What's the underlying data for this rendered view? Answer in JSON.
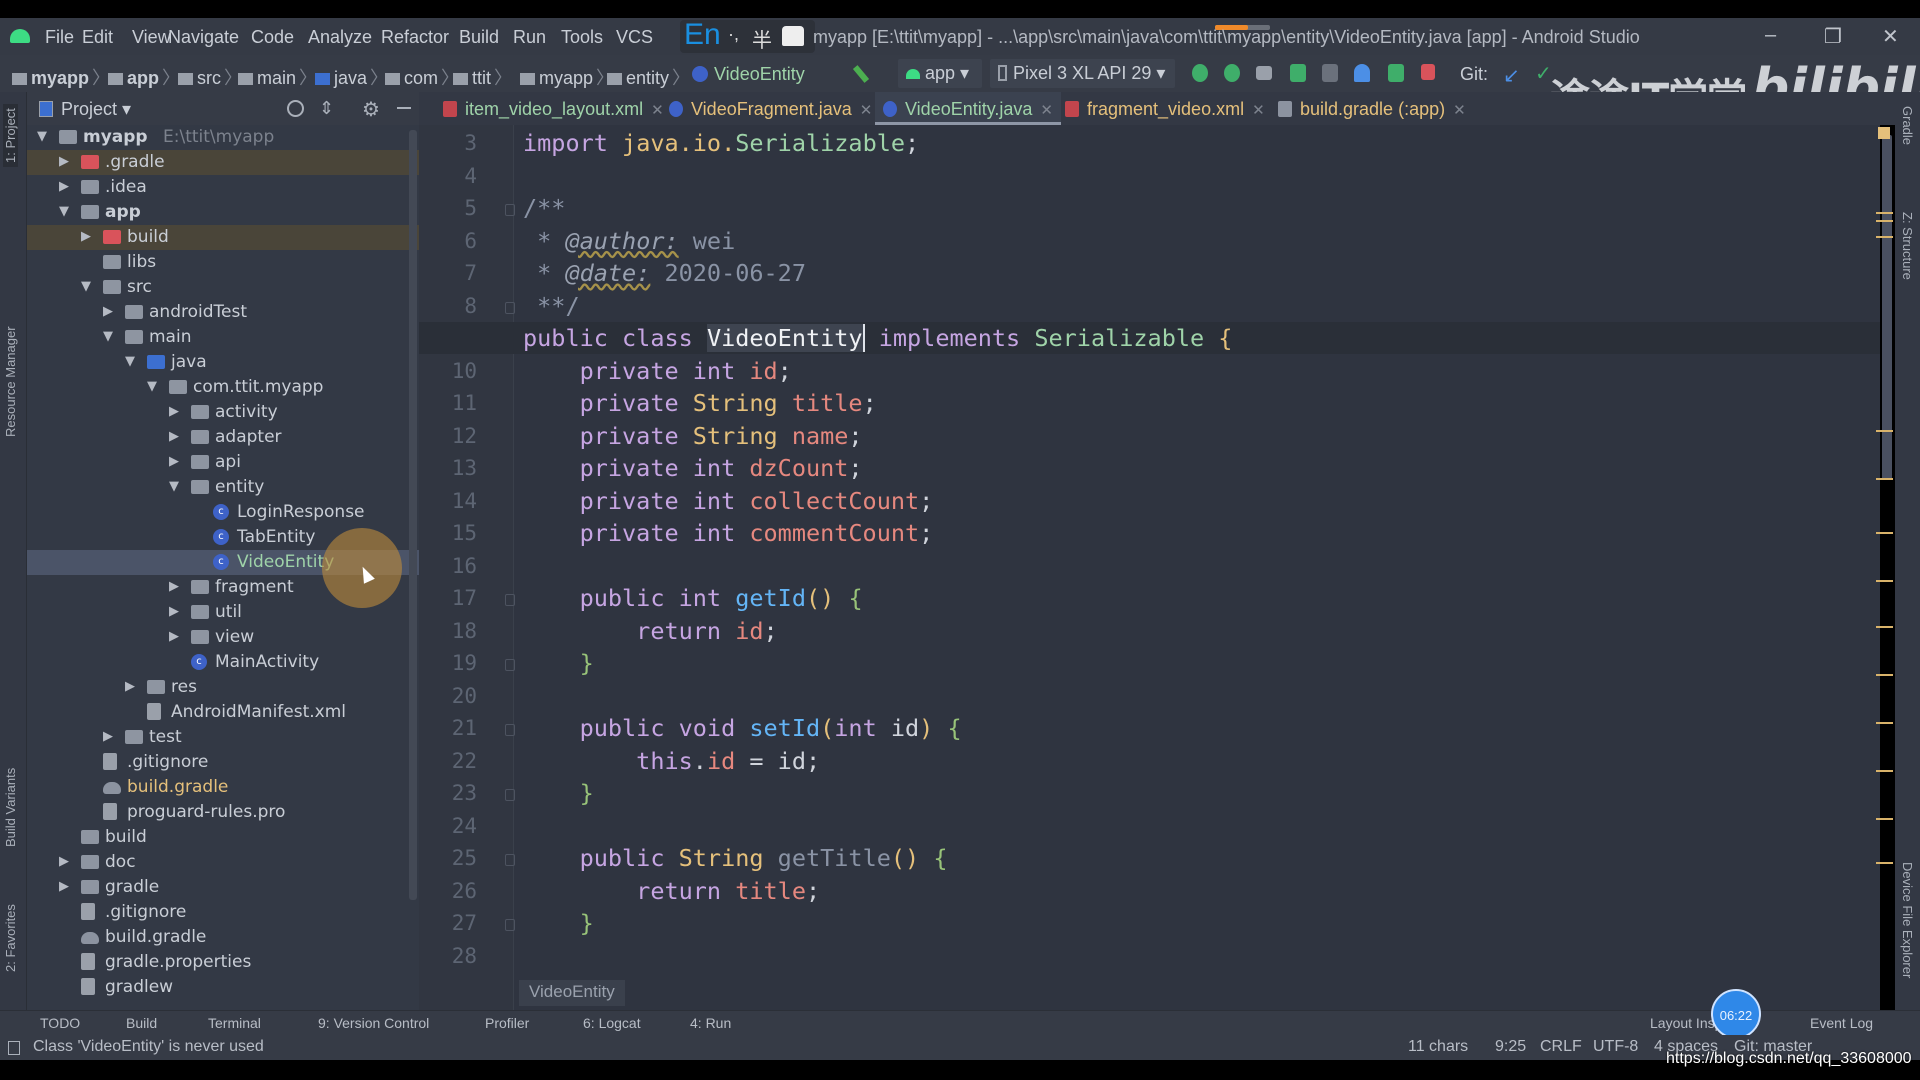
{
  "menu": [
    "File",
    "Edit",
    "View",
    "Navigate",
    "Code",
    "Analyze",
    "Refactor",
    "Build",
    "Run",
    "Tools",
    "VCS"
  ],
  "ime": {
    "lang": "En",
    "punct": "·,",
    "width": "半"
  },
  "window_title": "myapp [E:\\ttit\\myapp] - ...\\app\\src\\main\\java\\com\\ttit\\myapp\\entity\\VideoEntity.java [app] - Android Studio",
  "window_controls": {
    "minimize": "–",
    "restore": "❐",
    "close": "✕"
  },
  "breadcrumb": [
    "myapp",
    "app",
    "src",
    "main",
    "java",
    "com",
    "ttit",
    "myapp",
    "entity",
    "VideoEntity"
  ],
  "toolbar": {
    "run_config": "app",
    "device": "Pixel 3 XL API 29",
    "git_label": "Git:"
  },
  "watermark": {
    "channel": "途途IT学堂",
    "brand": "bilibili"
  },
  "project_panel": {
    "title": "Project"
  },
  "tree": [
    {
      "label": "myapp",
      "depth": 0,
      "state": "open",
      "icon": "module",
      "bold": true,
      "suffix": "E:\\ttit\\myapp"
    },
    {
      "label": ".gradle",
      "depth": 1,
      "state": "closed",
      "icon": "red",
      "hl": true
    },
    {
      "label": ".idea",
      "depth": 1,
      "state": "closed",
      "icon": "folder"
    },
    {
      "label": "app",
      "depth": 1,
      "state": "open",
      "icon": "folder",
      "bold": true
    },
    {
      "label": "build",
      "depth": 2,
      "state": "closed",
      "icon": "red",
      "hl": true
    },
    {
      "label": "libs",
      "depth": 2,
      "state": "none",
      "icon": "folder"
    },
    {
      "label": "src",
      "depth": 2,
      "state": "open",
      "icon": "folder"
    },
    {
      "label": "androidTest",
      "depth": 3,
      "state": "closed",
      "icon": "folder"
    },
    {
      "label": "main",
      "depth": 3,
      "state": "open",
      "icon": "folder"
    },
    {
      "label": "java",
      "depth": 4,
      "state": "open",
      "icon": "blue"
    },
    {
      "label": "com.ttit.myapp",
      "depth": 5,
      "state": "open",
      "icon": "pkg"
    },
    {
      "label": "activity",
      "depth": 6,
      "state": "closed",
      "icon": "pkg"
    },
    {
      "label": "adapter",
      "depth": 6,
      "state": "closed",
      "icon": "pkg"
    },
    {
      "label": "api",
      "depth": 6,
      "state": "closed",
      "icon": "pkg"
    },
    {
      "label": "entity",
      "depth": 6,
      "state": "open",
      "icon": "pkg"
    },
    {
      "label": "LoginResponse",
      "depth": 7,
      "state": "none",
      "icon": "cls"
    },
    {
      "label": "TabEntity",
      "depth": 7,
      "state": "none",
      "icon": "cls"
    },
    {
      "label": "VideoEntity",
      "depth": 7,
      "state": "none",
      "icon": "cls",
      "selected": true
    },
    {
      "label": "fragment",
      "depth": 6,
      "state": "closed",
      "icon": "pkg"
    },
    {
      "label": "util",
      "depth": 6,
      "state": "closed",
      "icon": "pkg"
    },
    {
      "label": "view",
      "depth": 6,
      "state": "closed",
      "icon": "pkg"
    },
    {
      "label": "MainActivity",
      "depth": 6,
      "state": "none",
      "icon": "cls"
    },
    {
      "label": "res",
      "depth": 4,
      "state": "closed",
      "icon": "folder"
    },
    {
      "label": "AndroidManifest.xml",
      "depth": 4,
      "state": "none",
      "icon": "file"
    },
    {
      "label": "test",
      "depth": 3,
      "state": "closed",
      "icon": "folder"
    },
    {
      "label": ".gitignore",
      "depth": 2,
      "state": "none",
      "icon": "file"
    },
    {
      "label": "build.gradle",
      "depth": 2,
      "state": "none",
      "icon": "gradle",
      "modified": true
    },
    {
      "label": "proguard-rules.pro",
      "depth": 2,
      "state": "none",
      "icon": "file"
    },
    {
      "label": "build",
      "depth": 1,
      "state": "none",
      "icon": "folder"
    },
    {
      "label": "doc",
      "depth": 1,
      "state": "closed",
      "icon": "folder"
    },
    {
      "label": "gradle",
      "depth": 1,
      "state": "closed",
      "icon": "folder"
    },
    {
      "label": ".gitignore",
      "depth": 1,
      "state": "none",
      "icon": "file"
    },
    {
      "label": "build.gradle",
      "depth": 1,
      "state": "none",
      "icon": "gradle"
    },
    {
      "label": "gradle.properties",
      "depth": 1,
      "state": "none",
      "icon": "file"
    },
    {
      "label": "gradlew",
      "depth": 1,
      "state": "none",
      "icon": "file"
    }
  ],
  "tabs": [
    {
      "label": "item_video_layout.xml",
      "color": "#9fd3a9",
      "icon": "#c2454d"
    },
    {
      "label": "VideoFragment.java",
      "color": "#e5c07b",
      "icon": "#3e62c8"
    },
    {
      "label": "VideoEntity.java",
      "color": "#9fd3a9",
      "icon": "#3e62c8",
      "active": true
    },
    {
      "label": "fragment_video.xml",
      "color": "#e5c07b",
      "icon": "#c2454d"
    },
    {
      "label": "build.gradle (:app)",
      "color": "#e5c07b",
      "icon": "#8c93a0"
    }
  ],
  "editor": {
    "current_line": 9,
    "first_line": 3,
    "lines": [
      [
        [
          "import ",
          "kw"
        ],
        [
          "java.io.",
          "type"
        ],
        [
          "Serializable",
          "cls"
        ],
        [
          ";",
          "plain"
        ]
      ],
      [],
      [
        [
          "/**",
          "cm"
        ]
      ],
      [
        [
          " * ",
          "cm"
        ],
        [
          "@author:",
          "doctag"
        ],
        [
          " wei",
          "cm"
        ]
      ],
      [
        [
          " * ",
          "cm"
        ],
        [
          "@date:",
          "doctag"
        ],
        [
          " 2020-06-27",
          "cm"
        ]
      ],
      [
        [
          " **/",
          "cm"
        ]
      ],
      [
        [
          "public class ",
          "kw"
        ],
        [
          "VideoEntity",
          "hl"
        ],
        [
          " implements ",
          "kw"
        ],
        [
          "Serializable",
          "cls"
        ],
        [
          " {",
          "brace"
        ]
      ],
      [
        [
          "    private int ",
          "kw"
        ],
        [
          "id",
          "fld"
        ],
        [
          ";",
          "plain"
        ]
      ],
      [
        [
          "    private ",
          "kw"
        ],
        [
          "String",
          "type"
        ],
        [
          " title",
          "fld"
        ],
        [
          ";",
          "plain"
        ]
      ],
      [
        [
          "    private ",
          "kw"
        ],
        [
          "String",
          "type"
        ],
        [
          " name",
          "fld"
        ],
        [
          ";",
          "plain"
        ]
      ],
      [
        [
          "    private int ",
          "kw"
        ],
        [
          "dzCount",
          "fld"
        ],
        [
          ";",
          "plain"
        ]
      ],
      [
        [
          "    private int ",
          "kw"
        ],
        [
          "collectCount",
          "fld"
        ],
        [
          ";",
          "plain"
        ]
      ],
      [
        [
          "    private int ",
          "kw"
        ],
        [
          "commentCount",
          "fld"
        ],
        [
          ";",
          "plain"
        ]
      ],
      [],
      [
        [
          "    public int ",
          "kw"
        ],
        [
          "getId",
          "fn"
        ],
        [
          "() ",
          "brace"
        ],
        [
          "{",
          "gbr"
        ]
      ],
      [
        [
          "        return ",
          "kw"
        ],
        [
          "id",
          "fld"
        ],
        [
          ";",
          "plain"
        ]
      ],
      [
        [
          "    }",
          "gbr"
        ]
      ],
      [],
      [
        [
          "    public void ",
          "kw"
        ],
        [
          "setId",
          "fn"
        ],
        [
          "(",
          "brace"
        ],
        [
          "int ",
          "kw"
        ],
        [
          "id",
          "plain"
        ],
        [
          ") ",
          "brace"
        ],
        [
          "{",
          "gbr"
        ]
      ],
      [
        [
          "        this",
          "kw"
        ],
        [
          ".",
          "plain"
        ],
        [
          "id",
          "fld"
        ],
        [
          " = id;",
          "plain"
        ]
      ],
      [
        [
          "    }",
          "gbr"
        ]
      ],
      [],
      [
        [
          "    public ",
          "kw"
        ],
        [
          "String",
          "type"
        ],
        [
          " getTitle",
          "dim"
        ],
        [
          "() ",
          "brace"
        ],
        [
          "{",
          "gbr"
        ]
      ],
      [
        [
          "        return ",
          "kw"
        ],
        [
          "title",
          "fld"
        ],
        [
          ";",
          "plain"
        ]
      ],
      [
        [
          "    }",
          "gbr"
        ]
      ],
      []
    ],
    "footer_breadcrumb": "VideoEntity"
  },
  "left_strip": [
    "1: Project",
    "Resource Manager",
    "Build Variants",
    "2: Favorites"
  ],
  "right_strip": [
    "Gradle",
    "Z: Structure",
    "Device File Explorer"
  ],
  "tool_windows": [
    "TODO",
    "Build",
    "Terminal",
    "9: Version Control",
    "Profiler",
    "6: Logcat",
    "4: Run"
  ],
  "tool_windows_right": [
    "Layout Inspector",
    "Event Log"
  ],
  "status": {
    "message": "Class 'VideoEntity' is never used",
    "chars": "11 chars",
    "position": "9:25",
    "line_sep": "CRLF",
    "encoding": "UTF-8",
    "indent": "4 spaces",
    "git": "Git: master"
  },
  "timer": "06:22",
  "url_watermark": "https://blog.csdn.net/qq_33608000",
  "colors": {
    "editor_bg": "#2f3440",
    "panel_bg": "#333945",
    "keyword": "#c6a5e2",
    "field": "#e6887f",
    "type": "#e5c07b",
    "class": "#9fd3a9",
    "method": "#64b5f6"
  }
}
